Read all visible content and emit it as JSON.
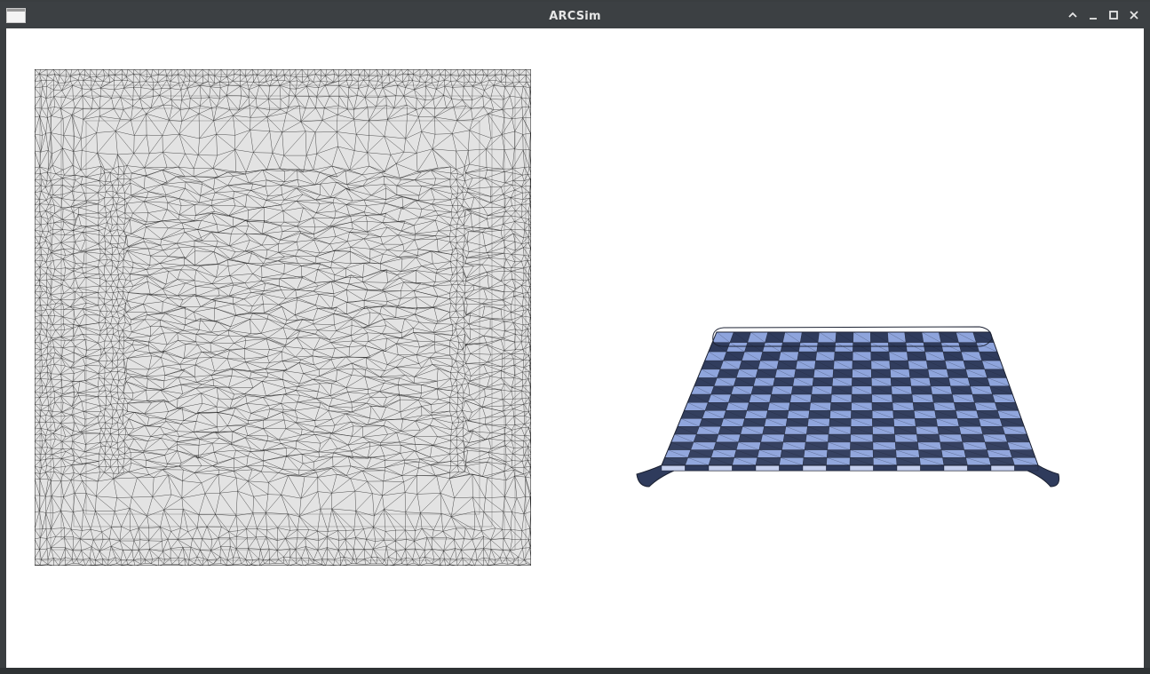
{
  "window": {
    "title": "ARCSim",
    "controls": {
      "collapse": "chevron-up-icon",
      "minimize": "minimize-icon",
      "maximize": "maximize-icon",
      "close": "close-icon"
    }
  },
  "colors": {
    "titlebar": "#3c4043",
    "canvas": "#ffffff",
    "mesh_fill": "#e3e3e3",
    "mesh_line": "#1f1f1f",
    "cloth_light": "#8ea4dc",
    "cloth_dark": "#2f3b5c"
  }
}
